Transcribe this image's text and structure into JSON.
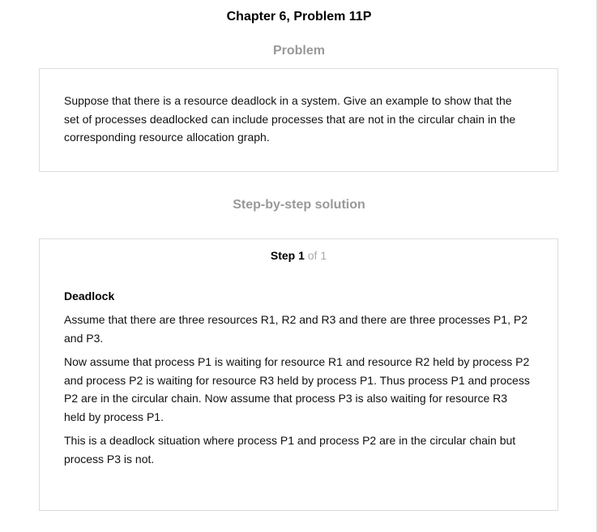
{
  "page_title": "Chapter 6, Problem 11P",
  "problem": {
    "heading": "Problem",
    "text": "Suppose that there is a resource deadlock in a system. Give an example to show that the set of processes deadlocked can include processes that are not in the circular chain in the corresponding resource allocation graph."
  },
  "solution": {
    "heading": "Step-by-step solution",
    "step": {
      "label": "Step 1",
      "of": "of 1"
    },
    "subheading": "Deadlock",
    "paragraphs": [
      "Assume that there are three resources R1, R2 and R3 and there are three processes P1, P2 and P3.",
      "Now assume that process P1 is waiting for resource R1 and resource R2 held by process P2 and process P2 is waiting for resource R3 held by process P1. Thus process P1 and process P2 are in the circular chain. Now assume that process P3 is also waiting for resource R3 held by process P1.",
      "This is a deadlock situation where process P1 and process P2 are in the circular chain but process P3 is not."
    ]
  }
}
